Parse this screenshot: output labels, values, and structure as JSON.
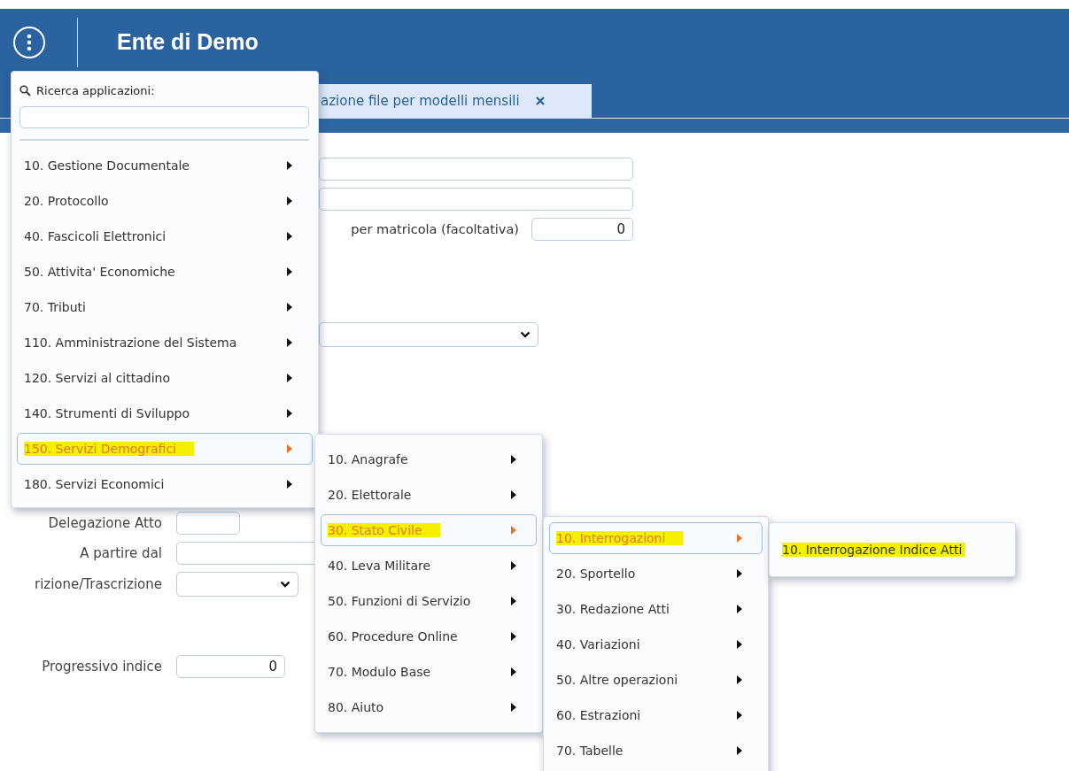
{
  "header": {
    "title": "Ente di Demo"
  },
  "tabs": [
    {
      "label": "azione file per modelli mensili",
      "selected": true
    }
  ],
  "form_top": [
    {
      "kind": "text"
    },
    {
      "kind": "text"
    },
    {
      "kind": "text",
      "label": "per matricola (facoltativa)",
      "value": "0"
    },
    {
      "kind": "select"
    }
  ],
  "form_bottom": [
    {
      "kind": "text",
      "label": "Delegazione Atto"
    },
    {
      "kind": "text",
      "label": "A partire dal"
    },
    {
      "kind": "select",
      "label": "rizione/Trascrizione"
    },
    {
      "kind": "text",
      "label": "Progressivo indice",
      "value": "0"
    }
  ],
  "app_menu": {
    "search_label": "Ricerca applicazioni:"
  },
  "menus": [
    {
      "items": [
        {
          "label": "10. Gestione Documentale",
          "kind": "submenu",
          "selected": false
        },
        {
          "label": "20. Protocollo",
          "kind": "submenu",
          "selected": false
        },
        {
          "label": "40. Fascicoli Elettronici",
          "kind": "submenu",
          "selected": false
        },
        {
          "label": "50. Attivita' Economiche",
          "kind": "submenu",
          "selected": false
        },
        {
          "label": "70. Tributi",
          "kind": "submenu",
          "selected": false
        },
        {
          "label": "110. Amministrazione del Sistema",
          "kind": "submenu",
          "selected": false
        },
        {
          "label": "120. Servizi al cittadino",
          "kind": "submenu",
          "selected": false
        },
        {
          "label": "140. Strumenti di Sviluppo",
          "kind": "submenu",
          "selected": false
        },
        {
          "label": "150. Servizi Demografici",
          "kind": "submenu",
          "selected": true
        },
        {
          "label": "180. Servizi Economici",
          "kind": "submenu",
          "selected": false
        }
      ]
    },
    {
      "items": [
        {
          "label": "10. Anagrafe",
          "kind": "submenu",
          "selected": false
        },
        {
          "label": "20. Elettorale",
          "kind": "submenu",
          "selected": false
        },
        {
          "label": "30. Stato Civile",
          "kind": "submenu",
          "selected": true
        },
        {
          "label": "40. Leva Militare",
          "kind": "submenu",
          "selected": false
        },
        {
          "label": "50. Funzioni di Servizio",
          "kind": "submenu",
          "selected": false
        },
        {
          "label": "60. Procedure Online",
          "kind": "submenu",
          "selected": false
        },
        {
          "label": "70. Modulo Base",
          "kind": "submenu",
          "selected": false
        },
        {
          "label": "80. Aiuto",
          "kind": "submenu",
          "selected": false
        }
      ]
    },
    {
      "items": [
        {
          "label": "10. Interrogazioni",
          "kind": "submenu",
          "selected": true
        },
        {
          "label": "20. Sportello",
          "kind": "submenu",
          "selected": false
        },
        {
          "label": "30. Redazione Atti",
          "kind": "submenu",
          "selected": false
        },
        {
          "label": "40. Variazioni",
          "kind": "submenu",
          "selected": false
        },
        {
          "label": "50. Altre operazioni",
          "kind": "submenu",
          "selected": false
        },
        {
          "label": "60. Estrazioni",
          "kind": "submenu",
          "selected": false
        },
        {
          "label": "70. Tabelle",
          "kind": "submenu",
          "selected": false
        }
      ]
    },
    {
      "items": [
        {
          "label": "10. Interrogazione Indice Atti",
          "kind": "leaf",
          "selected": true
        }
      ]
    }
  ]
}
